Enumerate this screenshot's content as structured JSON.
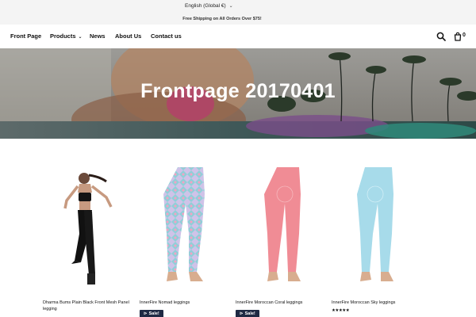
{
  "topbar": {
    "language": "English (Global €)",
    "shipping": "Free Shipping on All Orders Over $75!"
  },
  "nav": {
    "items": [
      "Front Page",
      "Products",
      "News",
      "About Us",
      "Contact us"
    ],
    "cart_count": "0"
  },
  "hero": {
    "title": "Frontpage 20170401"
  },
  "products": [
    {
      "title": "Dharma Bums Plain Black Front Mesh Panel legging",
      "badge": ""
    },
    {
      "title": "InnerFire Nomad leggings",
      "badge": "Sale!"
    },
    {
      "title": "InnerFire Moroccan Coral leggings",
      "badge": "Sale!"
    },
    {
      "title": "InnerFire Moroccan Sky leggings",
      "rating": 5
    }
  ],
  "colors": {
    "sale_badge": "#1f2a44",
    "nav_text": "#111111"
  }
}
